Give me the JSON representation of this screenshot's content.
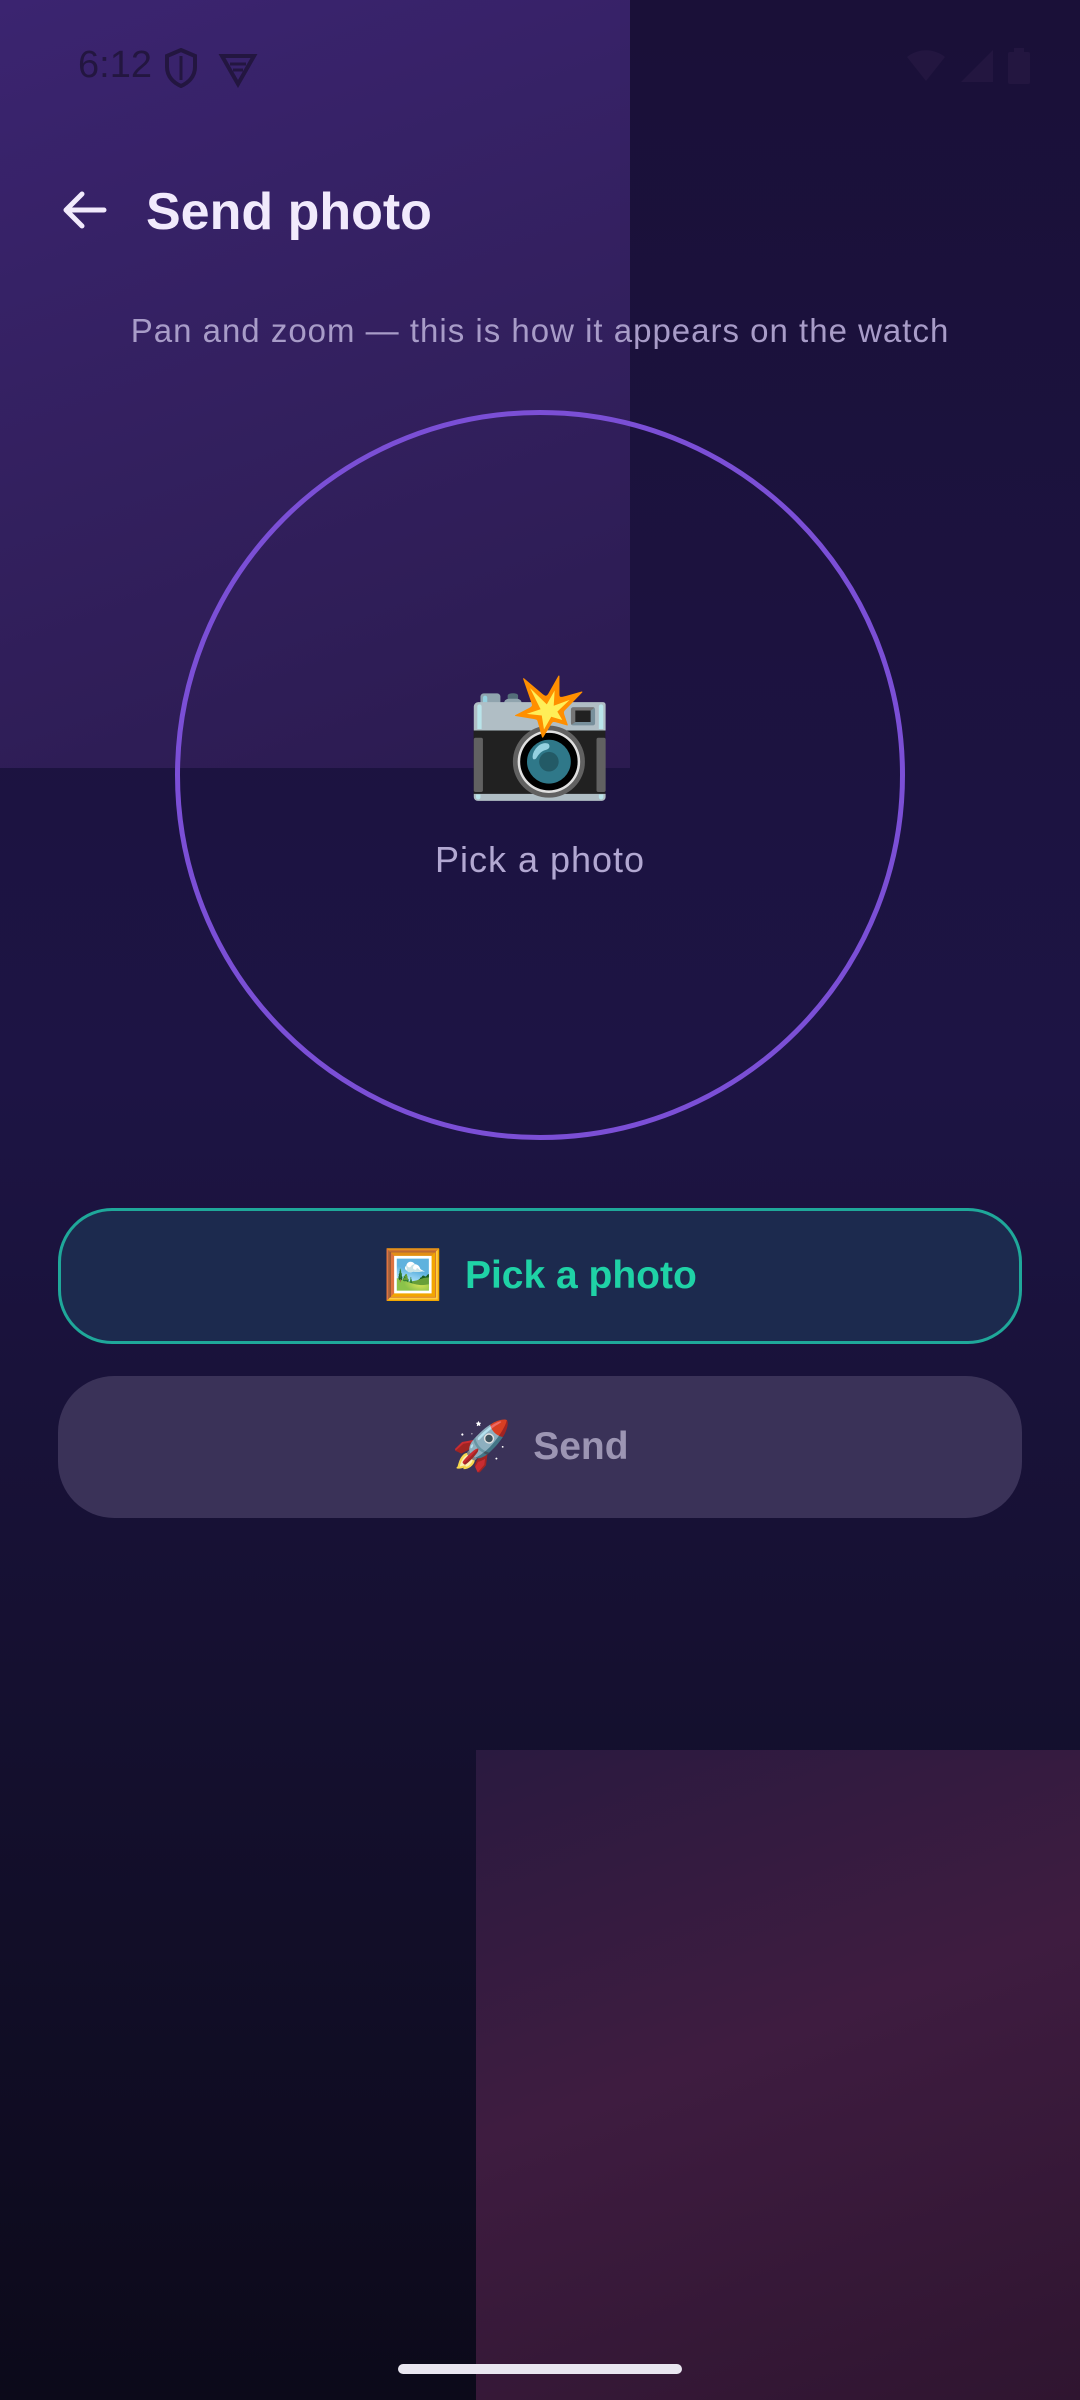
{
  "status_bar": {
    "time": "6:12"
  },
  "app_bar": {
    "title": "Send photo",
    "back_icon": "arrow-left-icon"
  },
  "hint": "Pan and zoom — this is how it appears on the watch",
  "preview": {
    "emoji": "📸",
    "label": "Pick a photo"
  },
  "buttons": {
    "pick": {
      "emoji": "🖼️",
      "label": "Pick a photo"
    },
    "send": {
      "emoji": "🚀",
      "label": "Send"
    }
  },
  "colors": {
    "accent_purple": "#7b4fd6",
    "accent_teal": "#1fd2a6",
    "title_text": "#f1eafc"
  }
}
